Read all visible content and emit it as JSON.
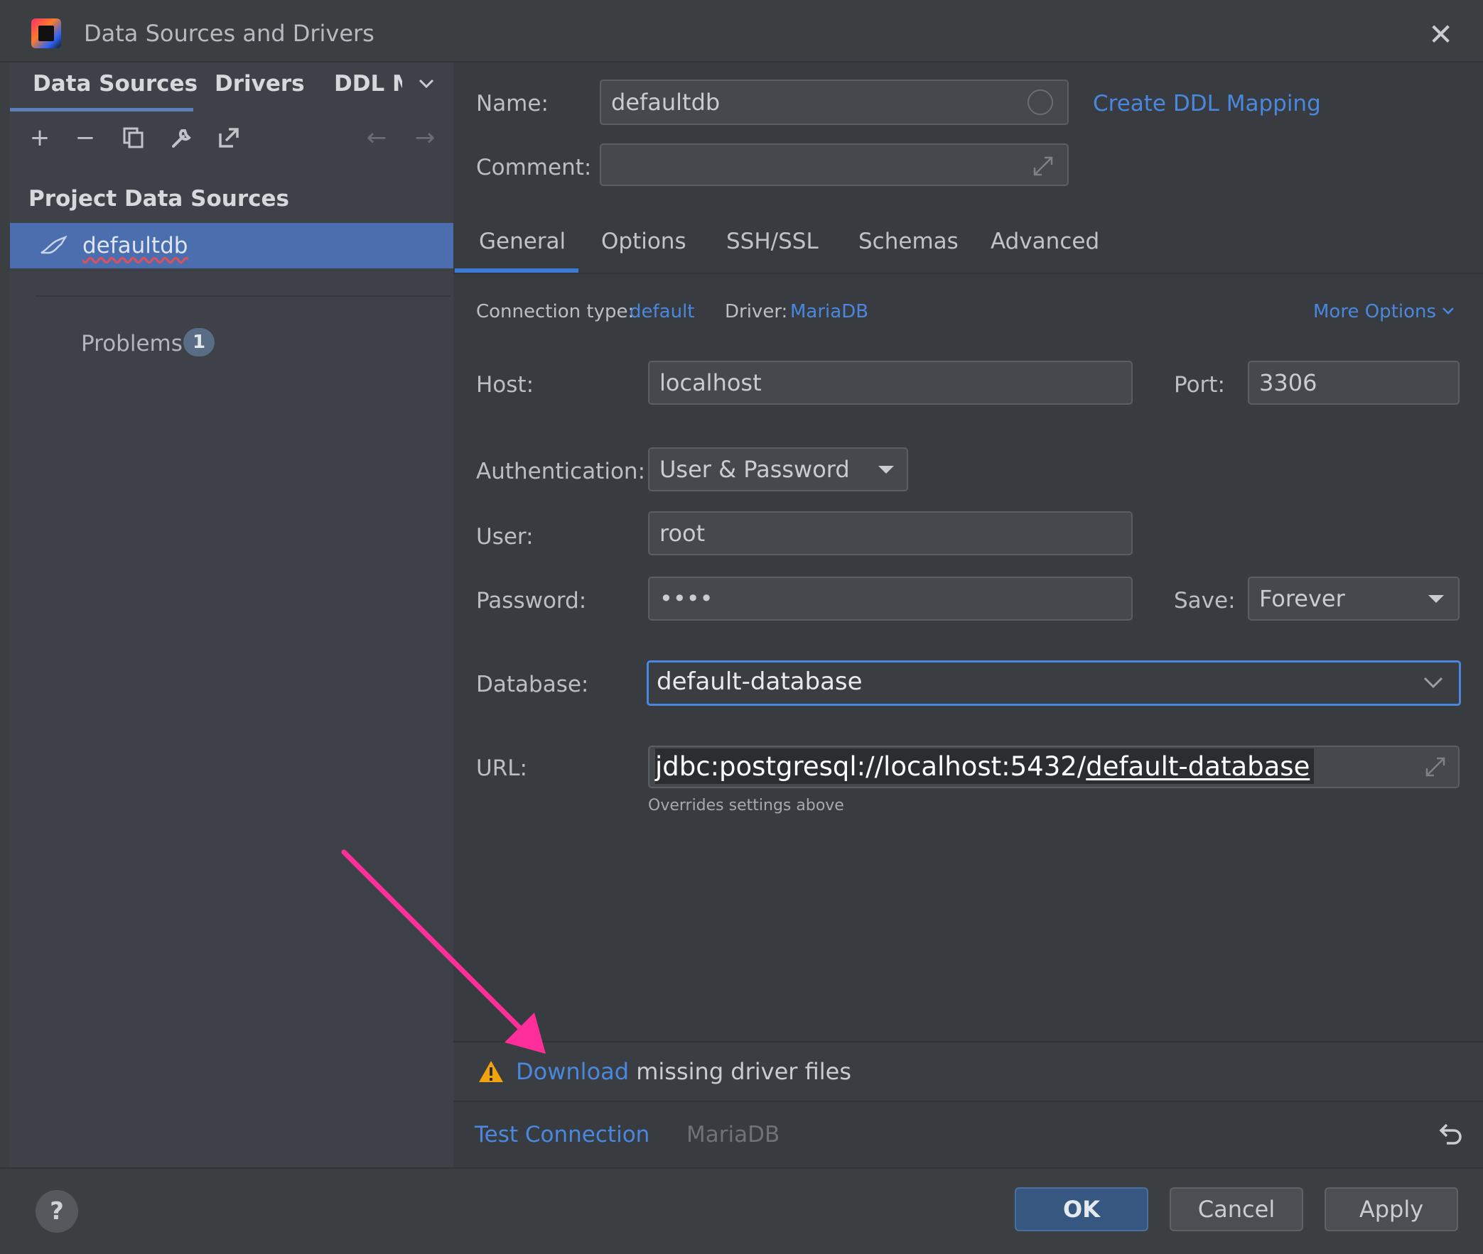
{
  "window": {
    "title": "Data Sources and Drivers"
  },
  "left_tabs": [
    "Data Sources",
    "Drivers",
    "DDL M"
  ],
  "section_title": "Project Data Sources",
  "data_source": "defaultdb",
  "problems": {
    "label": "Problems",
    "count": "1"
  },
  "name": {
    "label": "Name:",
    "value": "defaultdb"
  },
  "create_ddl_link": "Create DDL Mapping",
  "comment": {
    "label": "Comment:",
    "value": ""
  },
  "tabs": [
    "General",
    "Options",
    "SSH/SSL",
    "Schemas",
    "Advanced"
  ],
  "connection": {
    "type_label": "Connection type:",
    "type_value": "default",
    "driver_label": "Driver:",
    "driver_value": "MariaDB",
    "more_options": "More Options"
  },
  "host": {
    "label": "Host:",
    "value": "localhost"
  },
  "port": {
    "label": "Port:",
    "value": "3306"
  },
  "auth": {
    "label": "Authentication:",
    "value": "User & Password"
  },
  "user": {
    "label": "User:",
    "value": "root"
  },
  "password": {
    "label": "Password:",
    "value": "••••"
  },
  "save": {
    "label": "Save:",
    "value": "Forever"
  },
  "database": {
    "label": "Database:",
    "value": "default-database"
  },
  "url": {
    "label": "URL:",
    "prefix": "jdbc:postgresql://localhost:5432/",
    "db": "default-database",
    "hint": "Overrides settings above"
  },
  "warning": {
    "link": "Download",
    "text": " missing driver files"
  },
  "test_connection": "Test Connection",
  "driver_name": "MariaDB",
  "buttons": {
    "ok": "OK",
    "cancel": "Cancel",
    "apply": "Apply",
    "help": "?"
  },
  "colors": {
    "accent": "#4b6eaf",
    "link": "#4a88e0",
    "arrow": "#ff2e9a",
    "warning": "#f0a30a"
  }
}
